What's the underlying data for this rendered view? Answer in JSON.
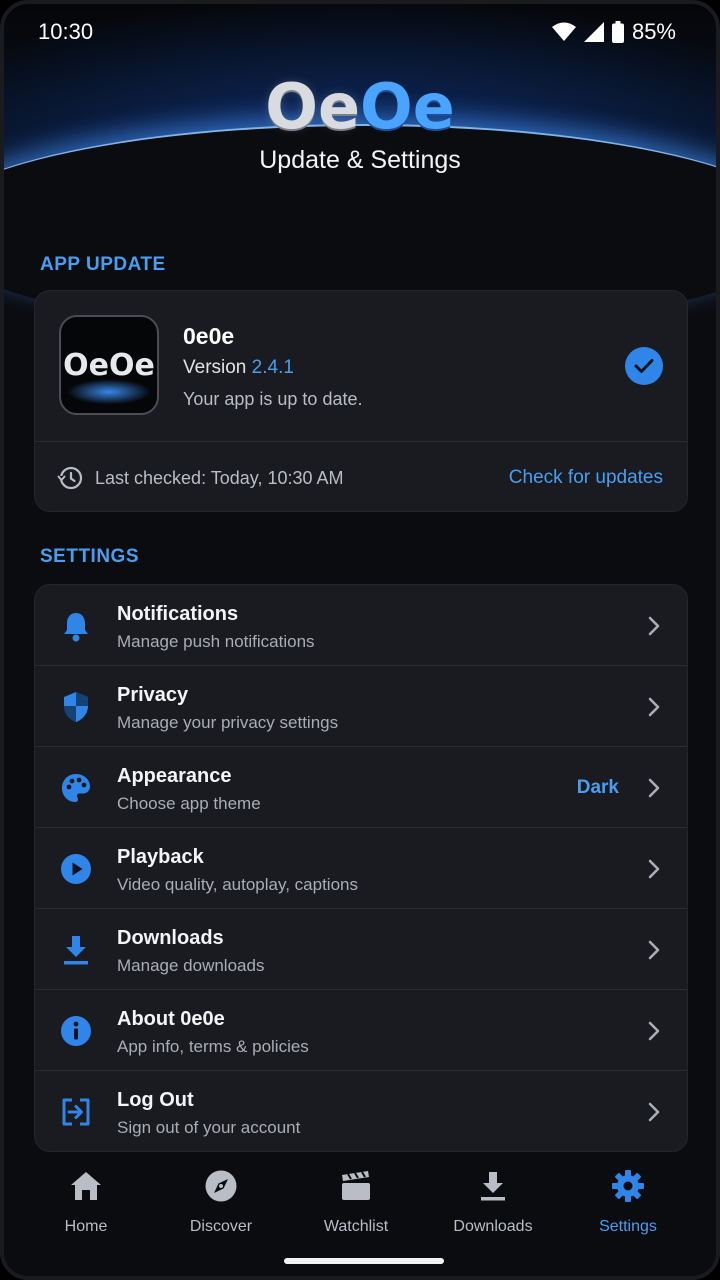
{
  "status_bar": {
    "time": "10:30",
    "battery": "85%"
  },
  "header": {
    "logo_left": "Oe",
    "logo_right": "Oe",
    "title": "Update & Settings"
  },
  "app_update": {
    "section_label": "APP UPDATE",
    "app_icon_text": "OeOe",
    "app_name": "0e0e",
    "version_label": "Version",
    "version_number": "2.4.1",
    "status": "Your app is up to date.",
    "last_checked": "Last checked: Today, 10:30 AM",
    "check_button": "Check for updates"
  },
  "settings": {
    "section_label": "SETTINGS",
    "items": [
      {
        "title": "Notifications",
        "subtitle": "Manage push notifications",
        "icon": "bell-icon"
      },
      {
        "title": "Privacy",
        "subtitle": "Manage your privacy settings",
        "icon": "shield-icon"
      },
      {
        "title": "Appearance",
        "subtitle": "Choose app theme",
        "value": "Dark",
        "icon": "palette-icon"
      },
      {
        "title": "Playback",
        "subtitle": "Video quality, autoplay, captions",
        "icon": "play-circle-icon"
      },
      {
        "title": "Downloads",
        "subtitle": "Manage downloads",
        "icon": "download-icon"
      },
      {
        "title": "About 0e0e",
        "subtitle": "App info, terms & policies",
        "icon": "info-icon"
      },
      {
        "title": "Log Out",
        "subtitle": "Sign out of your account",
        "icon": "logout-icon"
      }
    ]
  },
  "tabs": [
    {
      "label": "Home",
      "icon": "home-icon"
    },
    {
      "label": "Discover",
      "icon": "compass-icon"
    },
    {
      "label": "Watchlist",
      "icon": "clapperboard-icon"
    },
    {
      "label": "Downloads",
      "icon": "download-icon"
    },
    {
      "label": "Settings",
      "icon": "gear-icon",
      "active": true
    }
  ],
  "colors": {
    "accent": "#4a9ef0",
    "background": "#0b0c10",
    "card": "#191b21"
  }
}
